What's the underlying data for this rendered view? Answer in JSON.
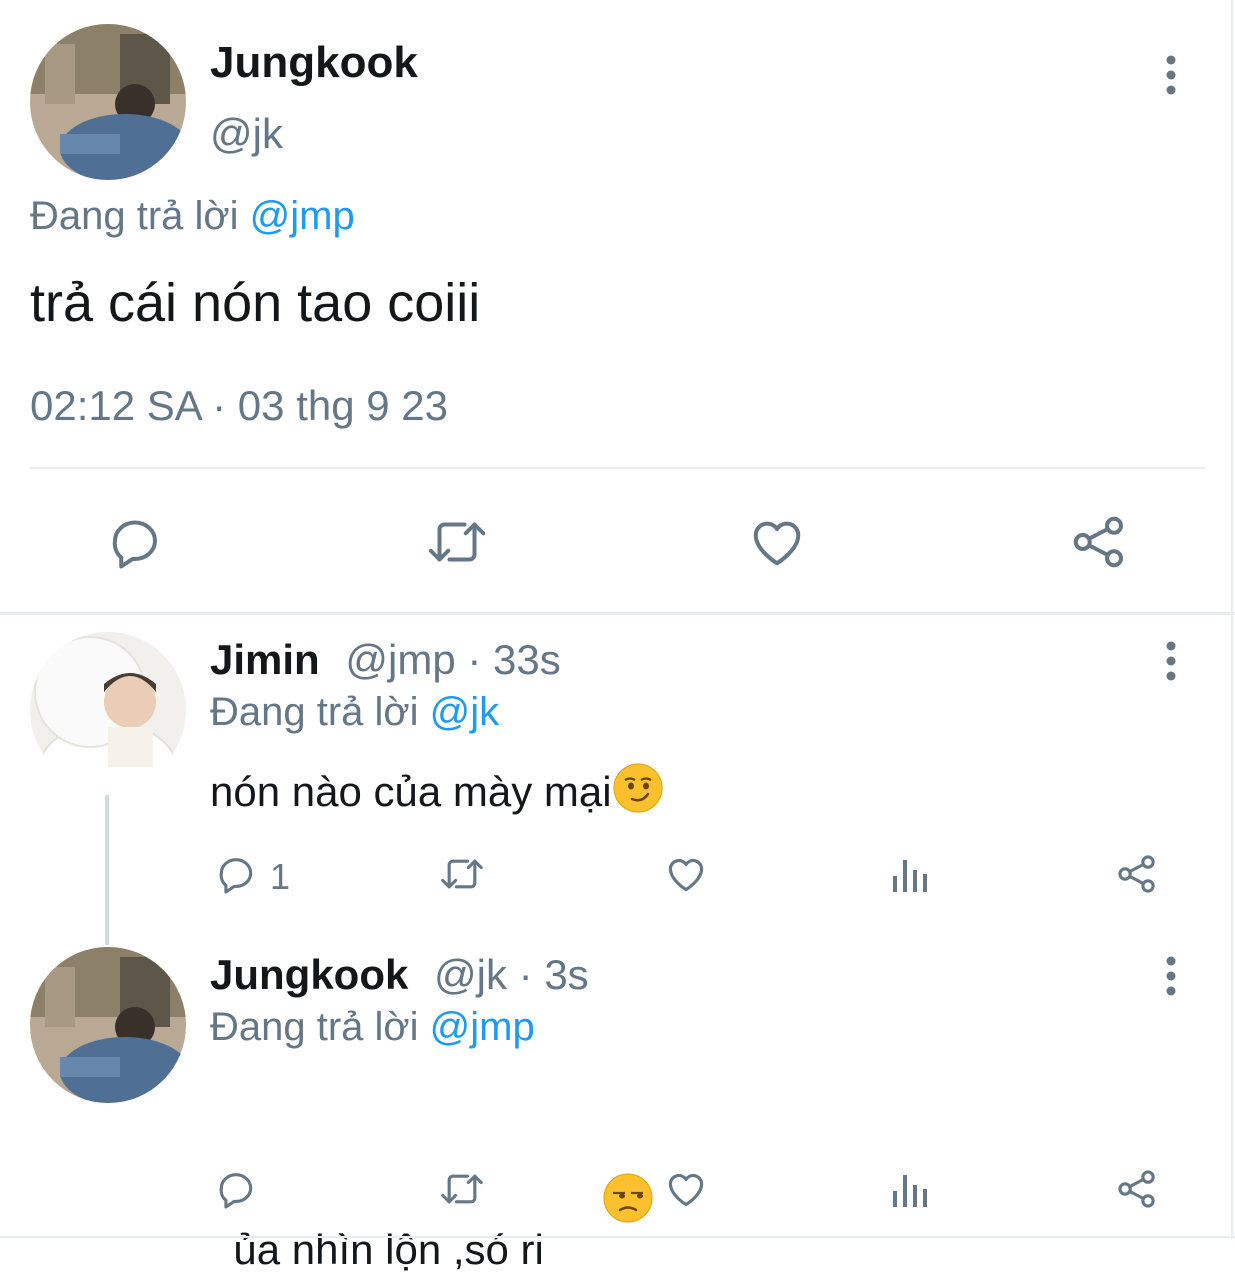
{
  "main_tweet": {
    "author_name": "Jungkook",
    "author_handle": "@jk",
    "reply_prefix": "Đang trả lời",
    "reply_to": "@jmp",
    "text": "trả cái nón tao coiii",
    "timestamp": "02:12 SA · 03 thg 9 23",
    "avatar_icon": "person-photo"
  },
  "replies": [
    {
      "author_name": "Jimin",
      "meta": "@jmp · 33s",
      "reply_prefix": "Đang trả lời",
      "reply_to": "@jk",
      "text": "nón nào của mày mại",
      "emoji": "smirking-face",
      "reply_count": "1"
    },
    {
      "author_name": "Jungkook",
      "meta": "@jk · 3s",
      "reply_prefix": "Đang trả lời",
      "reply_to": "@jmp",
      "text": "ủa nhìn lộn ,só ri ",
      "emoji": "unamused-face",
      "reply_count": ""
    }
  ],
  "colors": {
    "accent": "#1d9bf0",
    "icon": "#657786",
    "text": "#14171a"
  }
}
